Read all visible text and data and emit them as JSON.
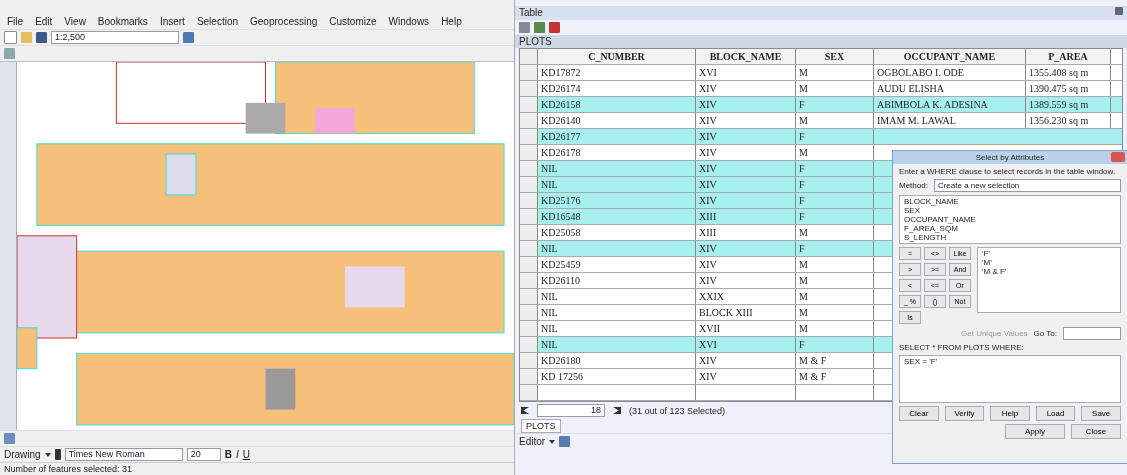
{
  "menu": [
    "File",
    "Edit",
    "View",
    "Bookmarks",
    "Insert",
    "Selection",
    "Geoprocessing",
    "Customize",
    "Windows",
    "Help"
  ],
  "scale": "1:2,500",
  "table_window": {
    "title": "Table",
    "layer_tab": "PLOTS"
  },
  "table": {
    "columns": [
      "C_NUMBER",
      "BLOCK_NAME",
      "SEX",
      "OCCUPANT_NAME",
      "P_AREA"
    ],
    "rows": [
      {
        "cells": [
          "KD17872",
          "XVI",
          "M",
          "OGBOLABO I. ODE",
          "1355.408 sq m"
        ],
        "selected": false
      },
      {
        "cells": [
          "KD26174",
          "XIV",
          "M",
          "AUDU ELISHA",
          "1390.475 sq m"
        ],
        "selected": false
      },
      {
        "cells": [
          "KD26158",
          "XIV",
          "F",
          "ABIMBOLA K. ADESINA",
          "1389.559 sq m"
        ],
        "selected": true
      },
      {
        "cells": [
          "KD26140",
          "XIV",
          "M",
          "IMAM M. LAWAL",
          "1356.230 sq m"
        ],
        "selected": false
      },
      {
        "cells": [
          "KD26177",
          "XIV",
          "F"
        ],
        "selected": true
      },
      {
        "cells": [
          "KD26178",
          "XIV",
          "M"
        ],
        "selected": false
      },
      {
        "cells": [
          "NIL",
          "XIV",
          "F"
        ],
        "selected": true
      },
      {
        "cells": [
          "NIL",
          "XIV",
          "F"
        ],
        "selected": true
      },
      {
        "cells": [
          "KD25176",
          "XIV",
          "F"
        ],
        "selected": true
      },
      {
        "cells": [
          "KD16548",
          "XIII",
          "F"
        ],
        "selected": true
      },
      {
        "cells": [
          "KD25058",
          "XIII",
          "M"
        ],
        "selected": false
      },
      {
        "cells": [
          "NIL",
          "XIV",
          "F"
        ],
        "selected": true
      },
      {
        "cells": [
          "KD25459",
          "XIV",
          "M"
        ],
        "selected": false
      },
      {
        "cells": [
          "KD26110",
          "XIV",
          "M"
        ],
        "selected": false
      },
      {
        "cells": [
          "NIL",
          "XXIX",
          "M"
        ],
        "selected": false
      },
      {
        "cells": [
          "NIL",
          "BLOCK XIII",
          "M"
        ],
        "selected": false
      },
      {
        "cells": [
          "NIL",
          "XVII",
          "M"
        ],
        "selected": false
      },
      {
        "cells": [
          "NIL",
          "XVI",
          "F"
        ],
        "selected": true
      },
      {
        "cells": [
          "KD26180",
          "XIV",
          "M & F"
        ],
        "selected": false
      },
      {
        "cells": [
          "KD 17256",
          "XIV",
          "M & F"
        ],
        "selected": false
      }
    ]
  },
  "record_number": "18",
  "selection_count": "(31 out of 123 Selected)",
  "bottom_tab": "PLOTS",
  "drawing_toolbar": {
    "menu": "Drawing",
    "font": "Times New Roman",
    "size": "20",
    "bold": "B",
    "italic": "I",
    "underline": "U"
  },
  "editor_menu": "Editor",
  "status_bar": "Number of features selected: 31",
  "dialog": {
    "title": "Select by Attributes",
    "instruction": "Enter a WHERE clause to select records in the table window.",
    "method_label": "Method:",
    "method": "Create a new selection",
    "fields": [
      "BLOCK_NAME",
      "SEX",
      "OCCUPANT_NAME",
      "F_AREA_SQM",
      "S_LENGTH"
    ],
    "operators": [
      "=",
      "<>",
      "Like",
      ">",
      ">=",
      "And",
      "<",
      "<=",
      "Or",
      "_ %",
      "()",
      "Not",
      "Is"
    ],
    "values": [
      "'F'",
      "'M'",
      "'M & F'"
    ],
    "unique_button": "Get Unique Values",
    "goto_label": "Go To:",
    "query_label": "SELECT * FROM PLOTS WHERE:",
    "query": "SEX = 'F'",
    "buttons": [
      "Clear",
      "Verify",
      "Help",
      "Load",
      "Save"
    ],
    "apply": "Apply",
    "close": "Close"
  }
}
